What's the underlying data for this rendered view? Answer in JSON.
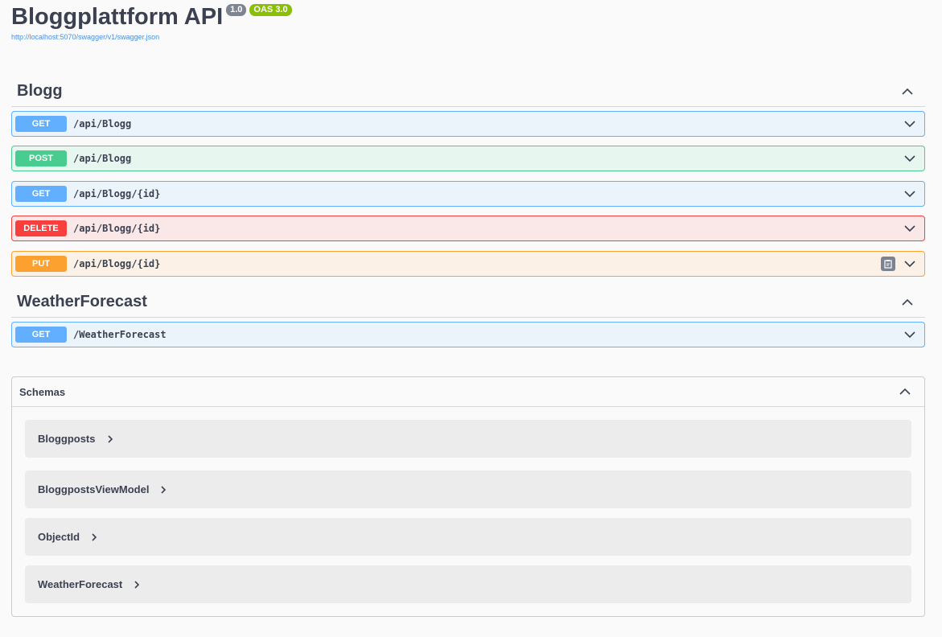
{
  "info": {
    "title": "Bloggplattform API",
    "version_badge": "1.0",
    "oas_badge": "OAS 3.0",
    "spec_url": "http://localhost:5070/swagger/v1/swagger.json"
  },
  "tags": [
    {
      "name": "Blogg",
      "operations": [
        {
          "method": "GET",
          "path": "/api/Blogg"
        },
        {
          "method": "POST",
          "path": "/api/Blogg"
        },
        {
          "method": "GET",
          "path": "/api/Blogg/{id}"
        },
        {
          "method": "DELETE",
          "path": "/api/Blogg/{id}"
        },
        {
          "method": "PUT",
          "path": "/api/Blogg/{id}"
        }
      ]
    },
    {
      "name": "WeatherForecast",
      "operations": [
        {
          "method": "GET",
          "path": "/WeatherForecast"
        }
      ]
    }
  ],
  "schemas": {
    "title": "Schemas",
    "models": [
      "Bloggposts",
      "BloggpostsViewModel",
      "ObjectId",
      "WeatherForecast"
    ]
  },
  "colors": {
    "get": "#61affe",
    "post": "#49cc90",
    "delete": "#f93e3e",
    "put": "#fca130"
  }
}
